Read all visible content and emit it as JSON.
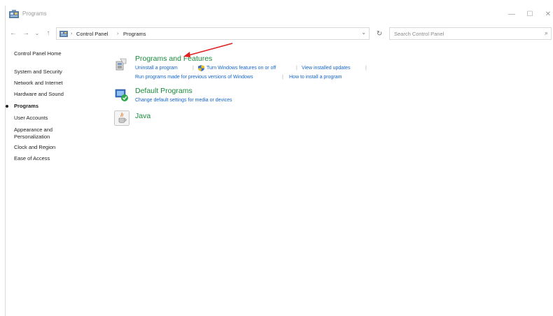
{
  "window": {
    "title": "Programs",
    "minimize_glyph": "—",
    "maximize_glyph": "☐",
    "close_glyph": "✕"
  },
  "nav": {
    "back_glyph": "←",
    "forward_glyph": "→",
    "recent_glyph": "⌄",
    "up_glyph": "↑"
  },
  "address": {
    "breadcrumbs": [
      "Control Panel",
      "Programs"
    ],
    "separator": "›",
    "dropdown_glyph": "⌄",
    "refresh_glyph": "↻"
  },
  "search": {
    "placeholder": "Search Control Panel",
    "icon_glyph": "⌕"
  },
  "sidebar": {
    "items": [
      {
        "label": "Control Panel Home",
        "active": false
      },
      {
        "label": "System and Security",
        "active": false
      },
      {
        "label": "Network and Internet",
        "active": false
      },
      {
        "label": "Hardware and Sound",
        "active": false
      },
      {
        "label": "Programs",
        "active": true
      },
      {
        "label": "User Accounts",
        "active": false
      },
      {
        "label": "Appearance and",
        "active": false
      },
      {
        "label": "Personalization",
        "active": false
      },
      {
        "label": "Clock and Region",
        "active": false
      },
      {
        "label": "Ease of Access",
        "active": false
      }
    ]
  },
  "categories": {
    "programs_features": {
      "title": "Programs and Features",
      "links": [
        "Uninstall a program",
        "Turn Windows features on or off",
        "View installed updates",
        "Run programs made for previous versions of Windows",
        "How to install a program"
      ]
    },
    "default_programs": {
      "title": "Default Programs",
      "links": [
        "Change default settings for media or devices"
      ]
    },
    "java": {
      "title": "Java"
    }
  },
  "colors": {
    "category_title": "#1a8a3c",
    "link": "#1464c8",
    "annotation_arrow": "#e02020"
  }
}
